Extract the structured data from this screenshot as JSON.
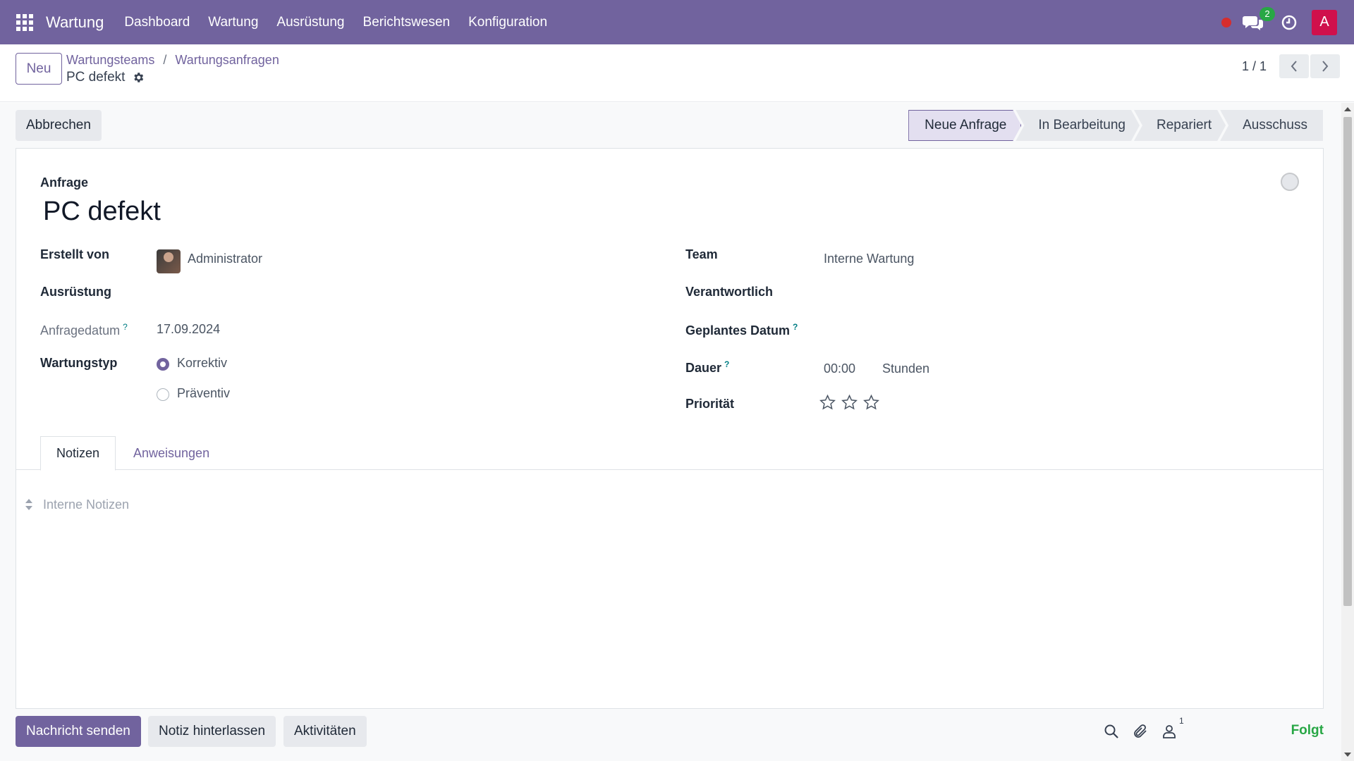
{
  "navbar": {
    "brand": "Wartung",
    "menu": [
      "Dashboard",
      "Wartung",
      "Ausrüstung",
      "Berichtswesen",
      "Konfiguration"
    ],
    "chat_count": "2",
    "user_initial": "A"
  },
  "control": {
    "new_button": "Neu",
    "breadcrumb": [
      "Wartungsteams",
      "Wartungsanfragen"
    ],
    "breadcrumb_separator": "/",
    "record_title": "PC defekt",
    "pager": "1 / 1"
  },
  "statusbar": {
    "cancel_button": "Abbrechen",
    "stages": [
      {
        "label": "Neue Anfrage",
        "active": true
      },
      {
        "label": "In Bearbeitung",
        "active": false
      },
      {
        "label": "Repariert",
        "active": false
      },
      {
        "label": "Ausschuss",
        "active": false
      }
    ]
  },
  "form": {
    "request_label": "Anfrage",
    "name": "PC defekt",
    "created_by": {
      "label": "Erstellt von",
      "value": "Administrator"
    },
    "equipment": {
      "label": "Ausrüstung",
      "value": ""
    },
    "request_date": {
      "label": "Anfragedatum",
      "value": "17.09.2024",
      "help": "?"
    },
    "maintenance_type": {
      "label": "Wartungstyp",
      "options": [
        "Korrektiv",
        "Präventiv"
      ],
      "selected": "Korrektiv"
    },
    "team": {
      "label": "Team",
      "value": "Interne Wartung"
    },
    "responsible": {
      "label": "Verantwortlich",
      "value": ""
    },
    "scheduled_date": {
      "label": "Geplantes Datum",
      "value": "",
      "help": "?"
    },
    "duration": {
      "label": "Dauer",
      "value": "00:00",
      "unit": "Stunden",
      "help": "?"
    },
    "priority": {
      "label": "Priorität",
      "stars_filled": 0,
      "stars_total": 3
    }
  },
  "tabs": [
    "Notizen",
    "Anweisungen"
  ],
  "notes": {
    "placeholder": "Interne Notizen"
  },
  "chatter": {
    "send_message": "Nachricht senden",
    "log_note": "Notiz hinterlassen",
    "activities": "Aktivitäten",
    "followers_count": "1",
    "follow_status": "Folgt"
  },
  "colors": {
    "brand": "#71639e",
    "follow": "#28a745",
    "badge": "#28a745",
    "avatar": "#d0104c"
  }
}
